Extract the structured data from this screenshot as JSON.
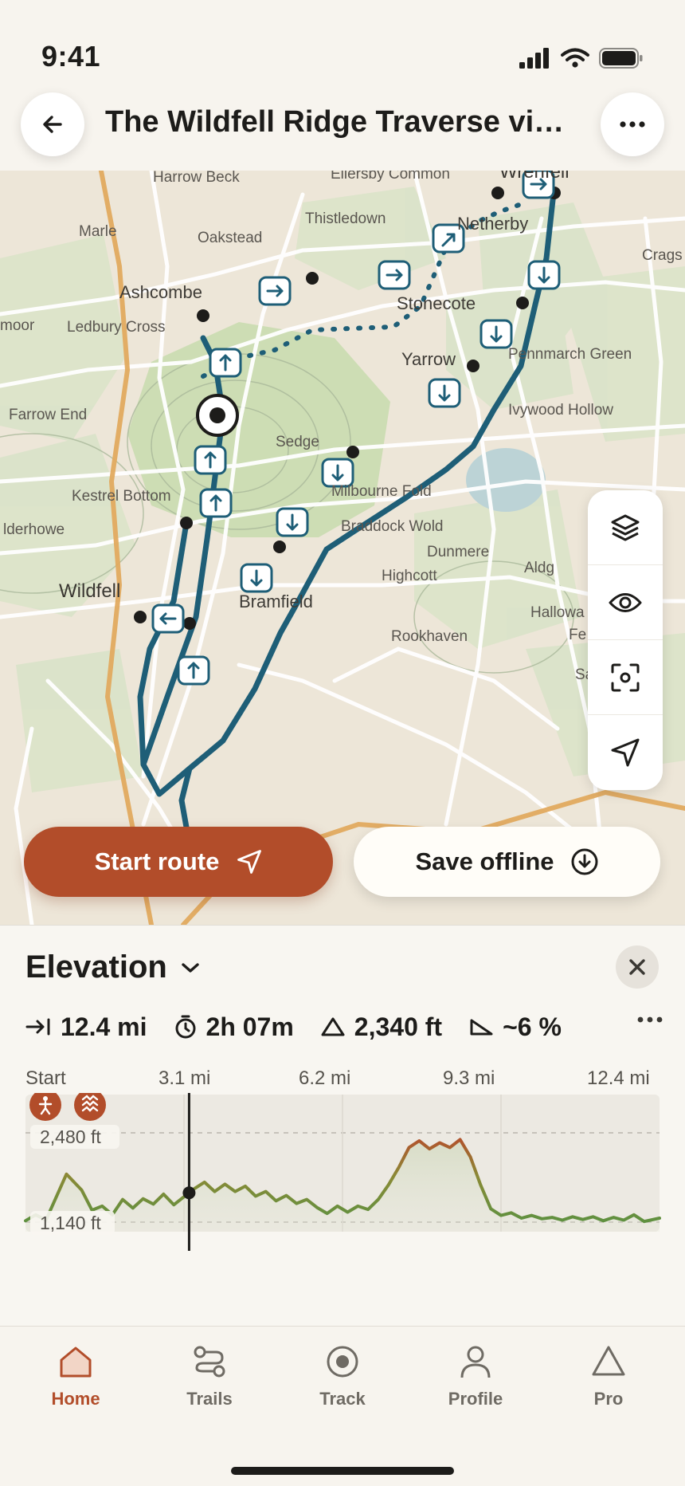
{
  "status": {
    "time": "9:41"
  },
  "header": {
    "title": "The Wildfell Ridge Traverse via Netherby"
  },
  "map": {
    "place_labels": [
      "Harrow Beck",
      "Ellersby Common",
      "Wrenfell",
      "Marle",
      "Oakstead",
      "Thistledown",
      "Netherby",
      "Crags",
      "Ashcombe",
      "Stonecote",
      "moor",
      "Ledbury Cross",
      "Yarrow",
      "Pennmarch Green",
      "Farrow End",
      "Ivywood Hollow",
      "Sedge",
      "Kestrel Bottom",
      "Milbourne Fold",
      "lderhowe",
      "Braddock Wold",
      "Dunmere",
      "Highcott",
      "Aldg",
      "Wildfell",
      "Bramfield",
      "Hallowa",
      "Rookhaven",
      "Fe",
      "Sallowby"
    ]
  },
  "actions": {
    "start_route": "Start route",
    "save_offline": "Save offline"
  },
  "elevation": {
    "title": "Elevation",
    "stats": {
      "distance": "12.4 mi",
      "duration": "2h 07m",
      "ascent": "2,340 ft",
      "grade": "~6 %"
    },
    "distance_ticks": [
      "Start",
      "3.1 mi",
      "6.2 mi",
      "9.3 mi",
      "12.4 mi"
    ],
    "max_label": "2,480 ft",
    "min_label": "1,140 ft"
  },
  "chart_data": {
    "type": "area",
    "xlabel": "",
    "ylabel": "",
    "x_tick_labels": [
      "Start",
      "3.1 mi",
      "6.2 mi",
      "9.3 mi",
      "12.4 mi"
    ],
    "y_tick_labels": [
      "2,480 ft",
      "1,140 ft"
    ],
    "ylim": [
      1140,
      2480
    ],
    "xlim": [
      0,
      12.4
    ],
    "cursor_x": 3.2,
    "x": [
      0,
      0.2,
      0.4,
      0.8,
      1.1,
      1.3,
      1.5,
      1.7,
      1.9,
      2.1,
      2.3,
      2.5,
      2.7,
      2.9,
      3.1,
      3.3,
      3.5,
      3.7,
      3.9,
      4.1,
      4.3,
      4.5,
      4.7,
      4.9,
      5.1,
      5.3,
      5.5,
      5.7,
      5.9,
      6.1,
      6.3,
      6.5,
      6.7,
      6.9,
      7.1,
      7.3,
      7.5,
      7.7,
      7.9,
      8.1,
      8.3,
      8.5,
      8.7,
      8.9,
      9.1,
      9.3,
      9.5,
      9.7,
      9.9,
      10.1,
      10.3,
      10.5,
      10.7,
      10.9,
      11.1,
      11.3,
      11.5,
      11.7,
      11.9,
      12.1,
      12.4
    ],
    "values": [
      1160,
      1250,
      1170,
      1860,
      1620,
      1320,
      1380,
      1250,
      1480,
      1350,
      1490,
      1410,
      1560,
      1400,
      1520,
      1640,
      1740,
      1600,
      1710,
      1600,
      1680,
      1530,
      1600,
      1460,
      1540,
      1420,
      1480,
      1360,
      1270,
      1380,
      1290,
      1380,
      1330,
      1480,
      1700,
      1960,
      2260,
      2360,
      2240,
      2330,
      2260,
      2380,
      2120,
      1700,
      1340,
      1240,
      1280,
      1200,
      1240,
      1190,
      1210,
      1170,
      1220,
      1180,
      1220,
      1160,
      1210,
      1170,
      1250,
      1150,
      1200
    ],
    "grid": true
  }
}
